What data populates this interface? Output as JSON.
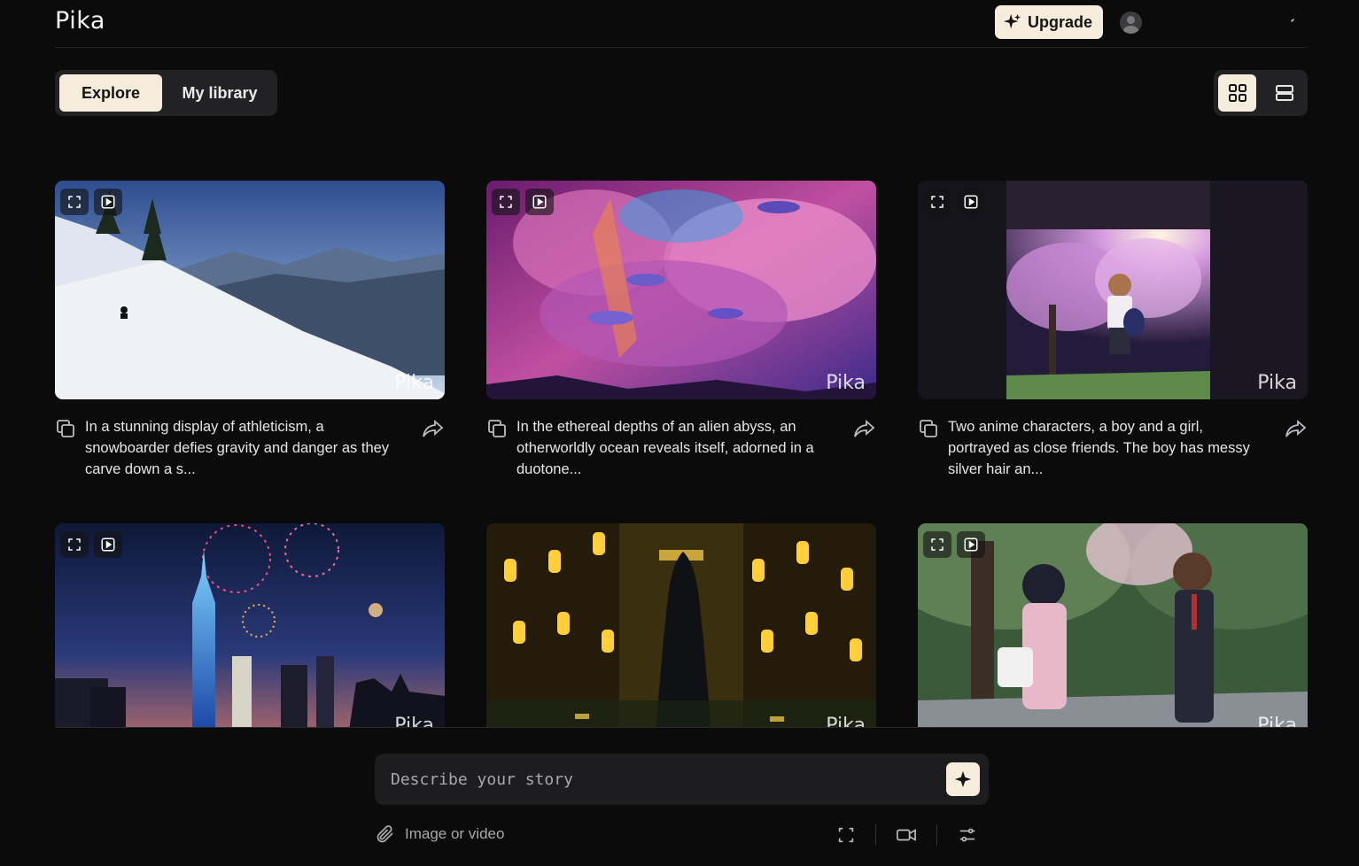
{
  "app": {
    "logo": "Pika"
  },
  "header": {
    "upgrade_label": "Upgrade"
  },
  "tabs": [
    {
      "label": "Explore",
      "active": true
    },
    {
      "label": "My library",
      "active": false
    }
  ],
  "view": {
    "mode": "grid"
  },
  "cards": [
    {
      "caption": "In a stunning display of athleticism, a snowboarder defies gravity and danger as they carve down a s...",
      "watermark": "Pika",
      "scene": "snow-mountain"
    },
    {
      "caption": "In the ethereal depths of an alien abyss, an otherworldly ocean reveals itself, adorned in a duotone...",
      "watermark": "Pika",
      "scene": "alien-ocean"
    },
    {
      "caption": "Two anime characters, a boy and a girl, portrayed as close friends. The boy has messy silver hair an...",
      "watermark": "Pika",
      "scene": "anime-girl"
    },
    {
      "caption": "",
      "watermark": "Pika",
      "scene": "city-fireworks"
    },
    {
      "caption": "",
      "watermark": "Pika",
      "scene": "lantern-temple"
    },
    {
      "caption": "",
      "watermark": "Pika",
      "scene": "anime-park"
    }
  ],
  "prompt": {
    "placeholder": "Describe your story",
    "attach_label": "Image or video"
  },
  "colors": {
    "accent": "#f6ecdb",
    "background": "#0b0b0c",
    "panel": "#222224"
  }
}
